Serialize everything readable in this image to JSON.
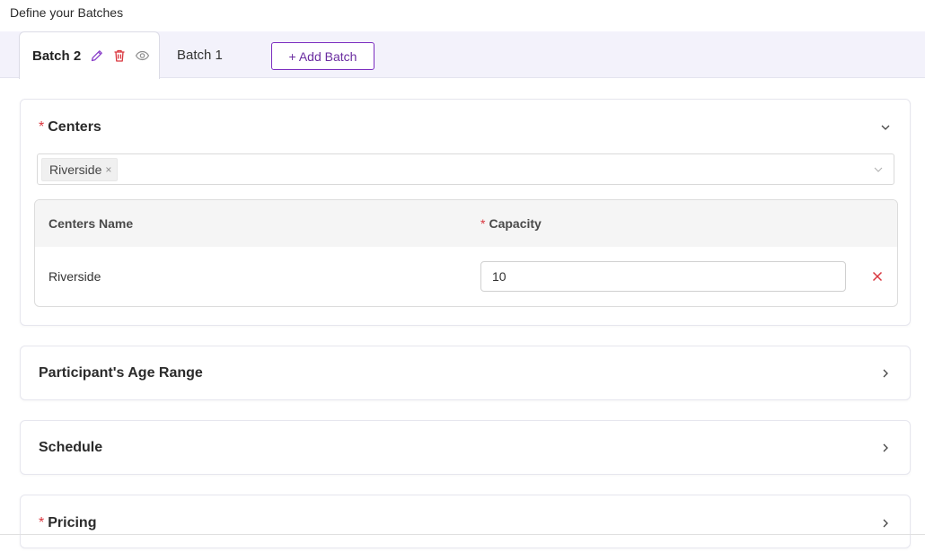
{
  "page": {
    "heading": "Define your Batches"
  },
  "tabs": {
    "active": {
      "label": "Batch 2",
      "icons": [
        "edit-icon",
        "trash-icon",
        "eye-icon"
      ]
    },
    "inactive": [
      {
        "label": "Batch 1"
      }
    ],
    "add_button": "+ Add Batch"
  },
  "centers": {
    "title": "Centers",
    "required_mark": "*",
    "expanded": true,
    "selected_tags": [
      {
        "label": "Riverside",
        "remove": "×"
      }
    ],
    "table": {
      "headers": {
        "name": "Centers Name",
        "capacity": "Capacity",
        "capacity_required": "*"
      },
      "rows": [
        {
          "name": "Riverside",
          "capacity": "10"
        }
      ]
    }
  },
  "sections": [
    {
      "title": "Participant's Age Range",
      "required": false,
      "expanded": false
    },
    {
      "title": "Schedule",
      "required": false,
      "expanded": false
    },
    {
      "title": "Pricing",
      "required": true,
      "required_mark": "*",
      "expanded": false
    }
  ],
  "colors": {
    "accent": "#7b2cbf",
    "danger": "#d9363e",
    "tabbar_bg": "#f3f2fb"
  }
}
